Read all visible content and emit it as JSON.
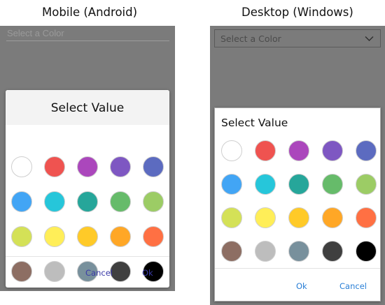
{
  "headings": {
    "mobile": "Mobile (Android)",
    "desktop": "Desktop (Windows)"
  },
  "mobile": {
    "select_placeholder": "Select a Color",
    "dialog_title": "Select Value",
    "cancel_label": "Cancel",
    "ok_label": "Ok"
  },
  "desktop": {
    "select_placeholder": "Select a Color",
    "dialog_title": "Select Value",
    "ok_label": "Ok",
    "cancel_label": "Cancel"
  },
  "palette": [
    [
      "#ffffff",
      "#ef5350",
      "#ab47bc",
      "#7e57c2",
      "#5c6bc0"
    ],
    [
      "#42a5f5",
      "#26c6da",
      "#26a69a",
      "#66bb6a",
      "#9ccc65"
    ],
    [
      "#d4e157",
      "#ffee58",
      "#ffca28",
      "#ffa726",
      "#ff7043"
    ],
    [
      "#8d6e63",
      "#bdbdbd",
      "#78909c",
      "#3f3f3f",
      "#000000"
    ]
  ]
}
